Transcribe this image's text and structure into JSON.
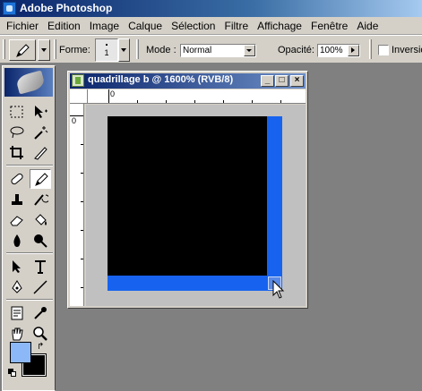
{
  "app": {
    "title": "Adobe Photoshop"
  },
  "menu": {
    "items": [
      "Fichier",
      "Edition",
      "Image",
      "Calque",
      "Sélection",
      "Filtre",
      "Affichage",
      "Fenêtre",
      "Aide"
    ]
  },
  "options": {
    "brush_label": "Forme:",
    "brush_size": "1",
    "mode_label": "Mode :",
    "mode_value": "Normal",
    "opacity_label": "Opacité:",
    "opacity_value": "100%",
    "invert_label": "Inversion"
  },
  "document": {
    "title": "quadrillage b @ 1600% (RVB/8)",
    "minimize_label": "_",
    "maximize_label": "□",
    "close_label": "×",
    "ruler_h_origin": "0",
    "ruler_v_origin": "0"
  },
  "colors": {
    "foreground": "#8cb8f8",
    "background": "#000000",
    "canvas_black": "#000000",
    "canvas_blue": "#1763ef"
  },
  "toolbox": {
    "tools": [
      "marquee-tool",
      "move-tool",
      "lasso-tool",
      "magic-wand-tool",
      "crop-tool",
      "slice-tool",
      "healing-brush-tool",
      "pencil-tool",
      "clone-stamp-tool",
      "history-brush-tool",
      "eraser-tool",
      "paint-bucket-tool",
      "blur-tool",
      "dodge-tool",
      "path-selection-tool",
      "type-tool",
      "pen-tool",
      "line-tool",
      "notes-tool",
      "eyedropper-tool",
      "hand-tool",
      "zoom-tool"
    ]
  }
}
